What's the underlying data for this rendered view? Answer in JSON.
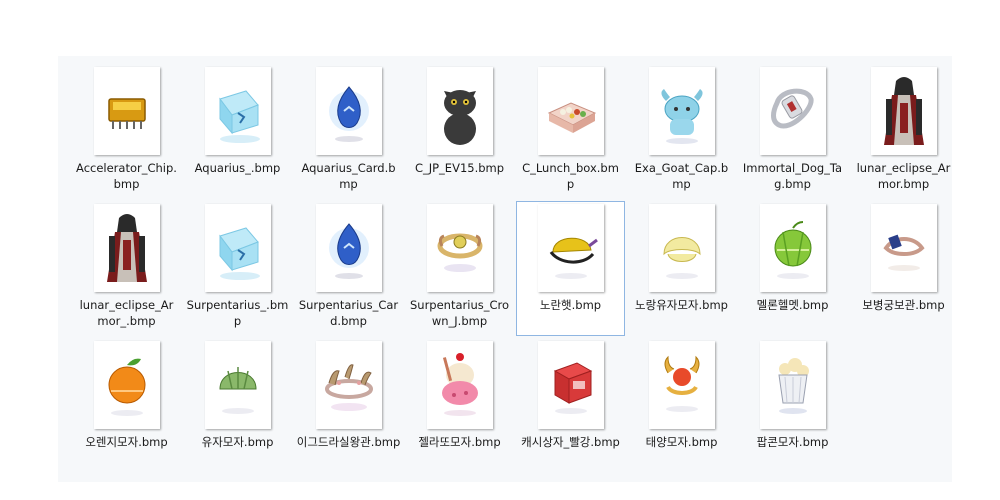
{
  "files": [
    {
      "name": "Accelerator_Chip.bmp",
      "icon": "gold-chip-icon"
    },
    {
      "name": "Aquarius_.bmp",
      "icon": "ice-cube-icon"
    },
    {
      "name": "Aquarius_Card.bmp",
      "icon": "blue-gem-icon"
    },
    {
      "name": "C_JP_EV15.bmp",
      "icon": "black-cat-icon"
    },
    {
      "name": "C_Lunch_box.bmp",
      "icon": "lunch-box-icon"
    },
    {
      "name": "Exa_Goat_Cap.bmp",
      "icon": "goat-cap-icon"
    },
    {
      "name": "Immortal_Dog_Tag.bmp",
      "icon": "dog-tag-icon"
    },
    {
      "name": "lunar_eclipse_Armor.bmp",
      "icon": "robe-armor-icon"
    },
    {
      "name": "lunar_eclipse_Armor_.bmp",
      "icon": "robe-armor-icon"
    },
    {
      "name": "Surpentarius_.bmp",
      "icon": "ice-cube-icon"
    },
    {
      "name": "Surpentarius_Card.bmp",
      "icon": "blue-gem-icon"
    },
    {
      "name": "Surpentarius_Crown_J.bmp",
      "icon": "crown-icon"
    },
    {
      "name": "노란햇.bmp",
      "icon": "yellow-hat-icon"
    },
    {
      "name": "노랑유자모자.bmp",
      "icon": "yellow-cap-icon"
    },
    {
      "name": "멜론헬멧.bmp",
      "icon": "melon-helmet-icon"
    },
    {
      "name": "보병궁보관.bmp",
      "icon": "circlet-icon"
    },
    {
      "name": "오렌지모자.bmp",
      "icon": "orange-hat-icon"
    },
    {
      "name": "유자모자.bmp",
      "icon": "green-cap-icon"
    },
    {
      "name": "이그드라실왕관.bmp",
      "icon": "leaf-crown-icon"
    },
    {
      "name": "젤라또모자.bmp",
      "icon": "gelato-hat-icon"
    },
    {
      "name": "캐시상자_빨강.bmp",
      "icon": "red-box-icon"
    },
    {
      "name": "태양모자.bmp",
      "icon": "sun-hat-icon"
    },
    {
      "name": "팝콘모자.bmp",
      "icon": "popcorn-hat-icon"
    }
  ],
  "selected_index": 12,
  "colors": {
    "panel_bg": "#f6f8fa",
    "selection_border": "#8fb6e2",
    "text": "#1a1a1a"
  }
}
